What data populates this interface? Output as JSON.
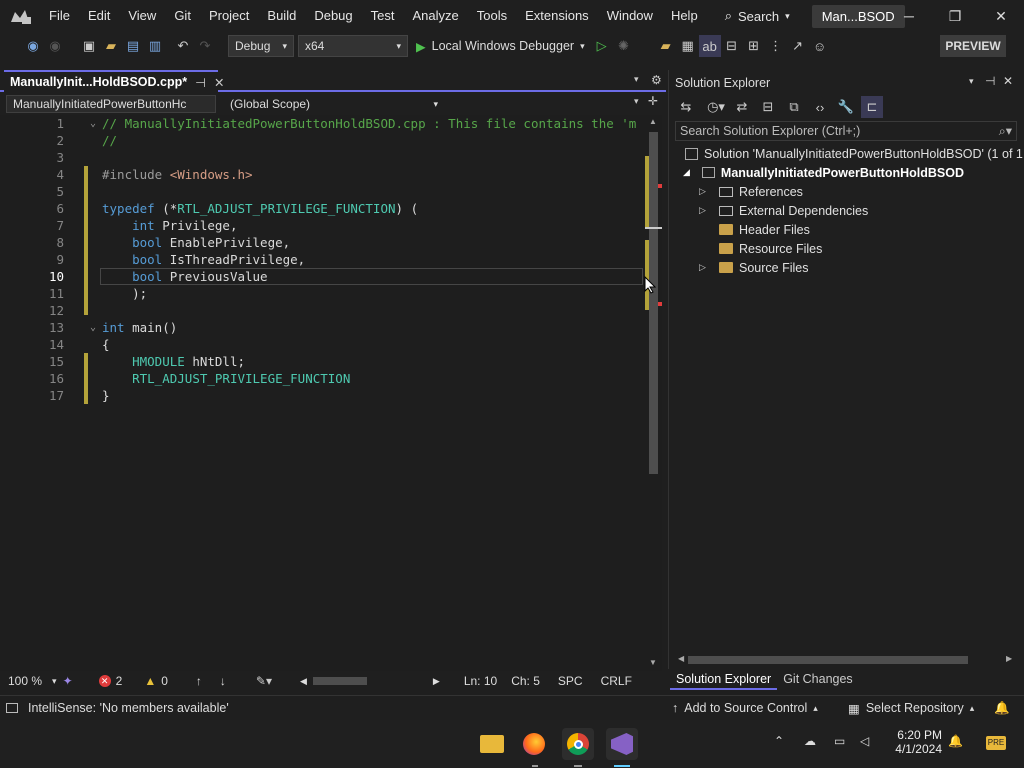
{
  "menu": {
    "items": [
      "File",
      "Edit",
      "View",
      "Git",
      "Project",
      "Build",
      "Debug",
      "Test",
      "Analyze",
      "Tools",
      "Extensions",
      "Window",
      "Help"
    ],
    "search_label": "Search",
    "title": "Man...BSOD"
  },
  "toolbar": {
    "config": "Debug",
    "platform": "x64",
    "debugger": "Local Windows Debugger",
    "preview": "PREVIEW"
  },
  "editor": {
    "tab_title": "ManuallyInit...HoldBSOD.cpp*",
    "nav_project": "ManuallyInitiatedPowerButtonHc",
    "nav_scope": "(Global Scope)",
    "lines": [
      {
        "n": "1",
        "tokens": [
          {
            "t": "// ManuallyInitiatedPowerButtonHoldBSOD.cpp : This file contains the 'm",
            "c": "cm"
          }
        ]
      },
      {
        "n": "2",
        "tokens": [
          {
            "t": "//",
            "c": "cm"
          }
        ]
      },
      {
        "n": "3",
        "tokens": []
      },
      {
        "n": "4",
        "tokens": [
          {
            "t": "#include ",
            "c": "pp"
          },
          {
            "t": "<Windows.h>",
            "c": "str"
          }
        ]
      },
      {
        "n": "5",
        "tokens": []
      },
      {
        "n": "6",
        "tokens": [
          {
            "t": "typedef",
            "c": "kw"
          },
          {
            "t": " (*",
            "c": "pun"
          },
          {
            "t": "RTL_ADJUST_PRIVILEGE_FUNCTION",
            "c": "tp"
          },
          {
            "t": ") (",
            "c": "pun"
          }
        ]
      },
      {
        "n": "7",
        "tokens": [
          {
            "t": "    ",
            "c": "pun"
          },
          {
            "t": "int",
            "c": "kw"
          },
          {
            "t": " Privilege,",
            "c": "id"
          }
        ]
      },
      {
        "n": "8",
        "tokens": [
          {
            "t": "    ",
            "c": "pun"
          },
          {
            "t": "bool",
            "c": "kw"
          },
          {
            "t": " EnablePrivilege,",
            "c": "id"
          }
        ]
      },
      {
        "n": "9",
        "tokens": [
          {
            "t": "    ",
            "c": "pun"
          },
          {
            "t": "bool",
            "c": "kw"
          },
          {
            "t": " IsThreadPrivilege,",
            "c": "id"
          }
        ]
      },
      {
        "n": "10",
        "tokens": [
          {
            "t": "    ",
            "c": "pun"
          },
          {
            "t": "bool",
            "c": "kw"
          },
          {
            "t": " PreviousValue",
            "c": "id"
          }
        ]
      },
      {
        "n": "11",
        "tokens": [
          {
            "t": "    );",
            "c": "pun"
          }
        ]
      },
      {
        "n": "12",
        "tokens": []
      },
      {
        "n": "13",
        "tokens": [
          {
            "t": "int",
            "c": "kw"
          },
          {
            "t": " main()",
            "c": "id"
          }
        ]
      },
      {
        "n": "14",
        "tokens": [
          {
            "t": "{",
            "c": "pun"
          }
        ]
      },
      {
        "n": "15",
        "tokens": [
          {
            "t": "    ",
            "c": "pun"
          },
          {
            "t": "HMODULE",
            "c": "tp"
          },
          {
            "t": " hNtDll;",
            "c": "id"
          }
        ]
      },
      {
        "n": "16",
        "tokens": [
          {
            "t": "    ",
            "c": "pun"
          },
          {
            "t": "RTL_ADJUST_PRIVILEGE_FUNCTION",
            "c": "tp"
          }
        ]
      },
      {
        "n": "17",
        "tokens": [
          {
            "t": "}",
            "c": "pun"
          }
        ]
      }
    ],
    "zoom": "100 %",
    "errors": "2",
    "warnings": "0",
    "ln": "Ln: 10",
    "ch": "Ch: 5",
    "spc": "SPC",
    "crlf": "CRLF"
  },
  "solution": {
    "panel_title": "Solution Explorer",
    "search_placeholder": "Search Solution Explorer (Ctrl+;)",
    "solution_label": "Solution 'ManuallyInitiatedPowerButtonHoldBSOD' (1 of 1",
    "project_label": "ManuallyInitiatedPowerButtonHoldBSOD",
    "items": [
      "References",
      "External Dependencies",
      "Header Files",
      "Resource Files",
      "Source Files"
    ],
    "bottom_tabs": [
      "Solution Explorer",
      "Git Changes"
    ]
  },
  "statusbar": {
    "message": "IntelliSense: 'No members available'",
    "add_source": "Add to Source Control",
    "select_repo": "Select Repository"
  },
  "taskbar": {
    "time": "6:20 PM",
    "date": "4/1/2024"
  }
}
